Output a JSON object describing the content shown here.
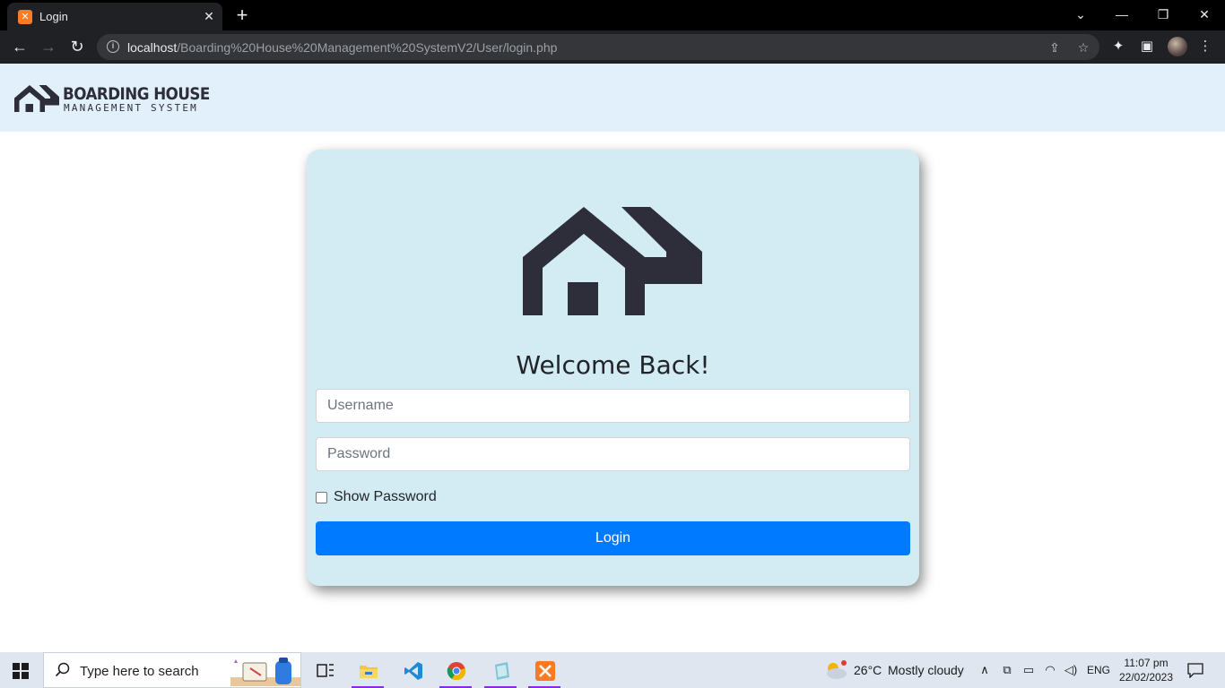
{
  "browser": {
    "tab_title": "Login",
    "tab_favicon": "xampp-icon",
    "url_host": "localhost",
    "url_path": "/Boarding%20House%20Management%20SystemV2/User/login.php"
  },
  "navbar": {
    "brand_title": "BOARDING HOUSE",
    "brand_subtitle": "MANAGEMENT SYSTEM"
  },
  "login": {
    "heading": "Welcome Back!",
    "username_placeholder": "Username",
    "password_placeholder": "Password",
    "show_password_label": "Show Password",
    "show_password_checked": false,
    "submit_label": "Login"
  },
  "colors": {
    "navbar_bg": "#e1f0fb",
    "card_bg": "#d3ebf3",
    "primary": "#007bff",
    "logo_dark": "#2d2e3a"
  },
  "taskbar": {
    "search_placeholder": "Type here to search",
    "apps": [
      "task-view-icon",
      "file-explorer-icon",
      "vscode-icon",
      "chrome-icon",
      "notepad-icon",
      "xampp-icon"
    ],
    "weather_temp": "26°C",
    "weather_text": "Mostly cloudy",
    "language": "ENG",
    "time": "11:07 pm",
    "date": "22/02/2023"
  }
}
